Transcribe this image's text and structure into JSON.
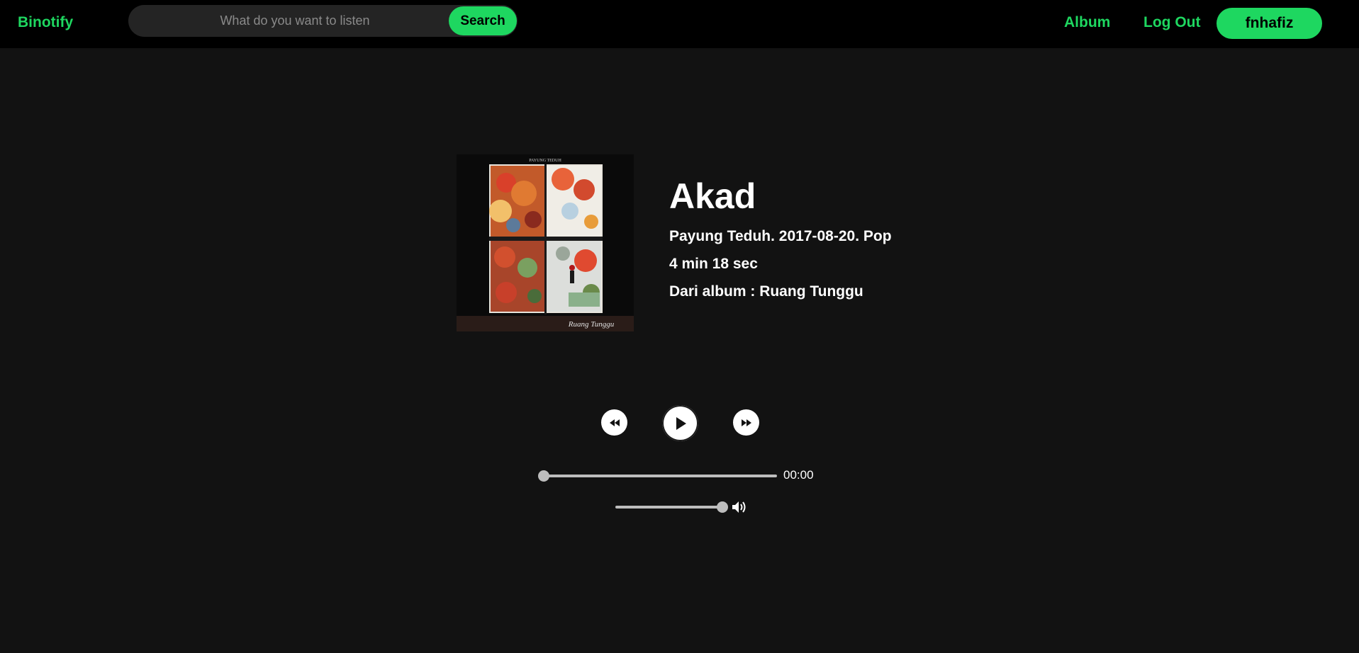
{
  "app": {
    "logo": "Binotify"
  },
  "search": {
    "placeholder": "What do you want to listen",
    "button_label": "Search"
  },
  "nav": {
    "album_label": "Album",
    "logout_label": "Log Out",
    "username": "fnhafiz"
  },
  "song": {
    "title": "Akad",
    "artist_date_genre": "Payung Teduh. 2017-08-20. Pop",
    "duration": "4 min 18 sec",
    "album_line": "Dari album : Ruang Tunggu"
  },
  "cover": {
    "top_text": "PAYUNG TEDUH",
    "signature": "Ruang Tunggu"
  },
  "player": {
    "current_time": "00:00",
    "progress": 0,
    "volume": 1,
    "icons": {
      "prev": "rewind-icon",
      "play": "play-icon",
      "next": "fast-forward-icon",
      "volume": "speaker-icon"
    }
  },
  "colors": {
    "accent": "#1ed760",
    "background": "#121212",
    "navbar": "#000000"
  }
}
